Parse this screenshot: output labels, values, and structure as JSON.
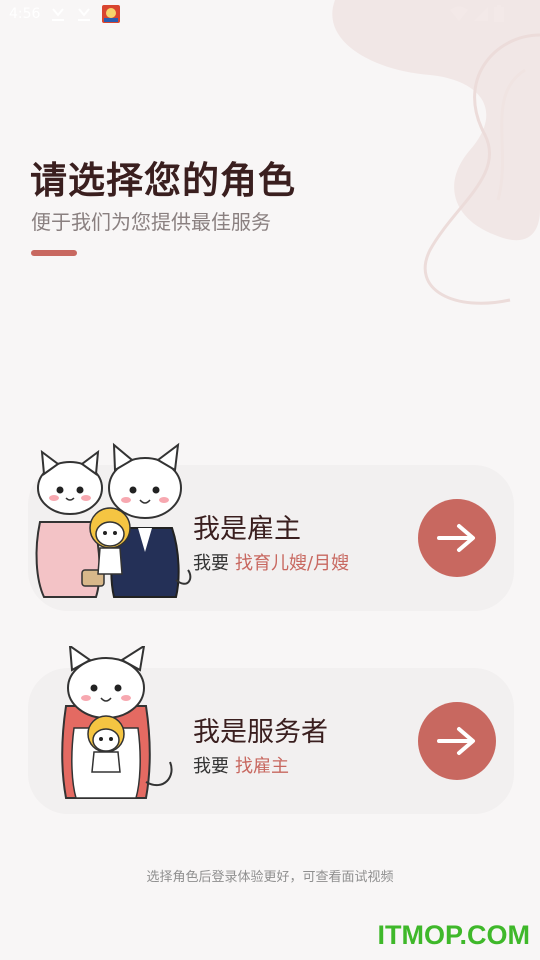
{
  "status_bar": {
    "time": "4:56"
  },
  "header": {
    "title": "请选择您的角色",
    "subtitle": "便于我们为您提供最佳服务"
  },
  "roles": [
    {
      "title": "我是雇主",
      "prefix": "我要",
      "target": "找育儿嫂/月嫂"
    },
    {
      "title": "我是服务者",
      "prefix": "我要",
      "target": "找雇主"
    }
  ],
  "footer": {
    "hint": "选择角色后登录体验更好，可查看面试视频"
  },
  "watermark": {
    "text": "ITMOP.COM"
  },
  "colors": {
    "accent": "#c86860",
    "title": "#3a1f1f",
    "background": "#f8f6f6",
    "card": "#f2f0f0",
    "watermark": "#3fb82a"
  },
  "icons": [
    "download-icon",
    "app-icon",
    "wifi-icon",
    "signal-icon",
    "battery-icon",
    "arrow-right-icon"
  ]
}
